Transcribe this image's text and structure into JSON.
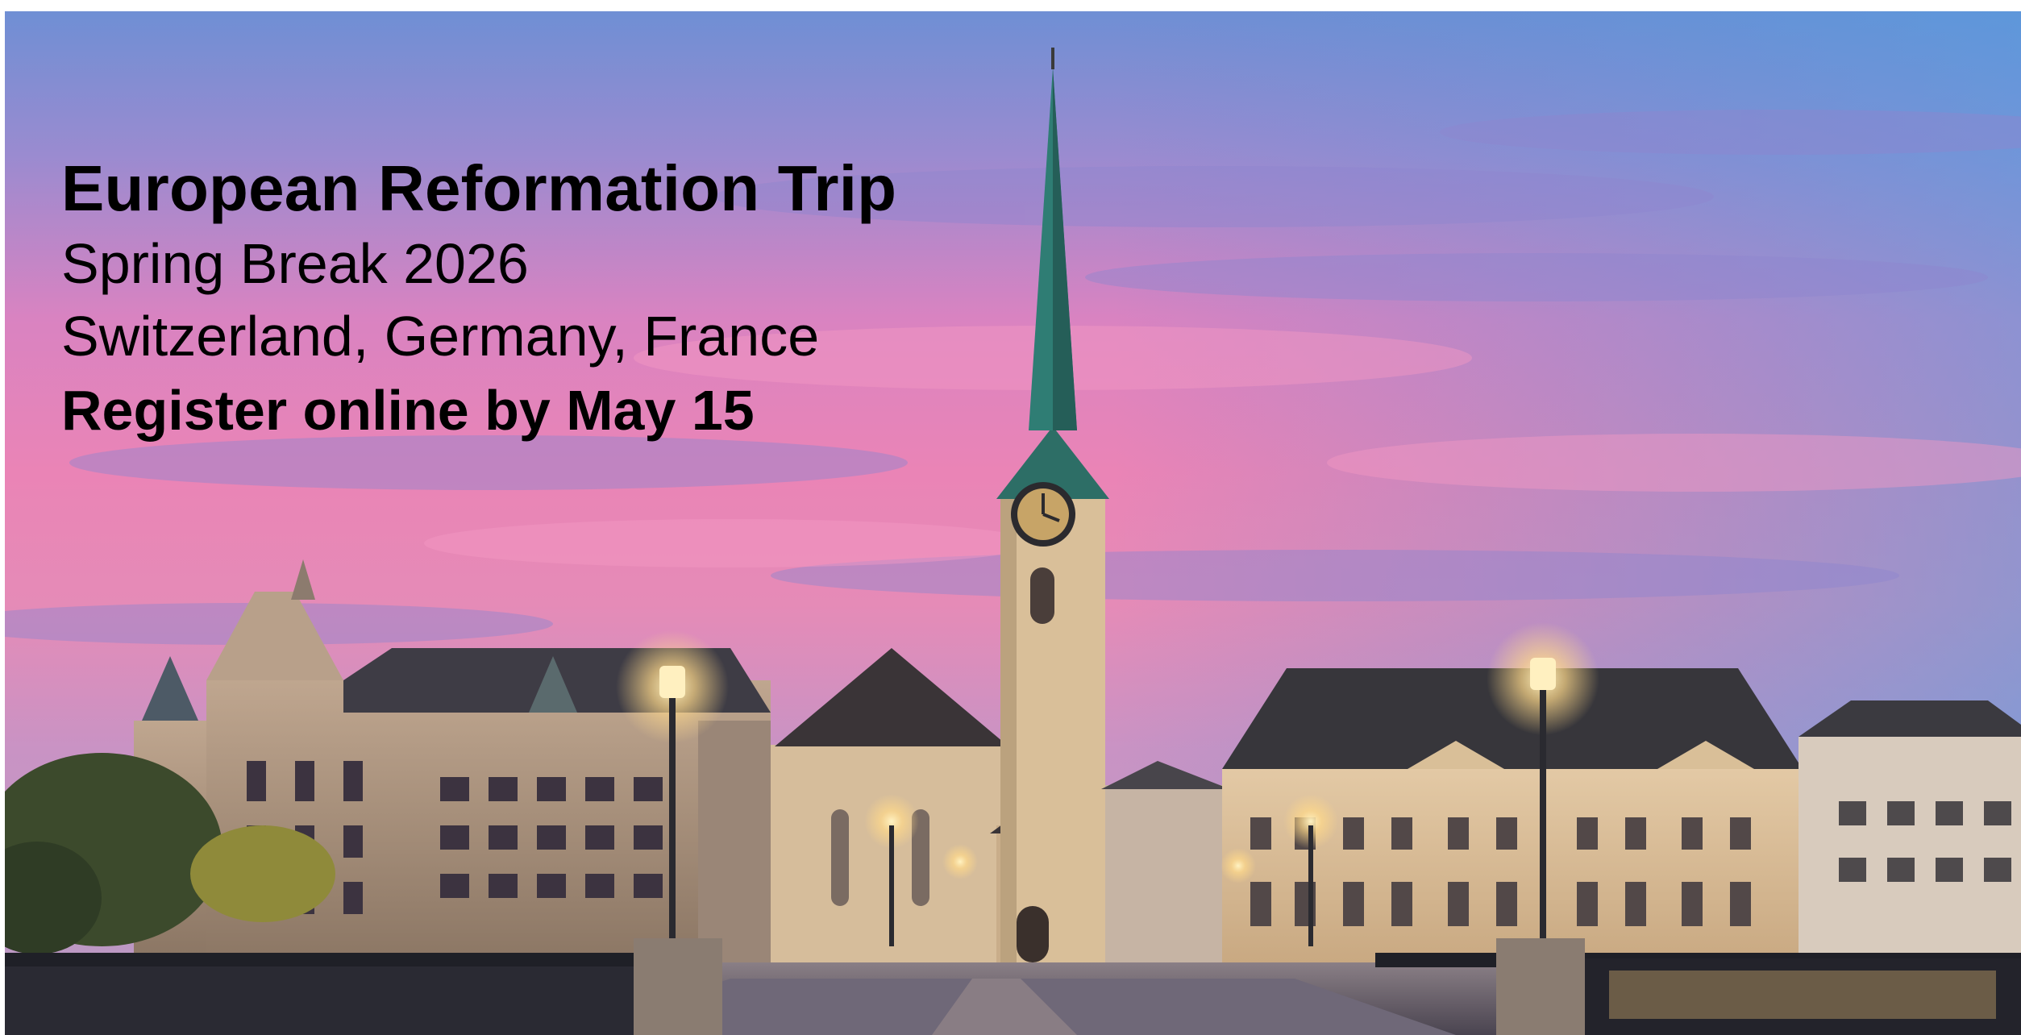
{
  "flyer": {
    "title": "European Reformation Trip",
    "subtitle": "Spring Break 2026",
    "countries": "Switzerland, Germany, France",
    "call_to_action": "Register online by May 15"
  },
  "photo": {
    "sky_top": "#6f92d6",
    "sky_pink": "#e77fb6",
    "stone": "#cfb596",
    "roof": "#3b3a3e",
    "spire": "#2f7d74",
    "lamp": "#ffd98a"
  }
}
